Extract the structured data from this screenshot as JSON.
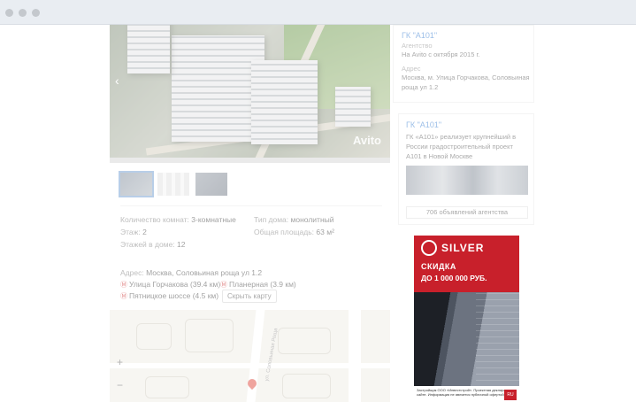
{
  "window": {
    "controls": [
      "close",
      "minimize",
      "maximize"
    ]
  },
  "listing": {
    "photo_watermark": "Avito",
    "params": [
      {
        "label": "Количество комнат:",
        "value": "3-комнатные"
      },
      {
        "label": "Этаж:",
        "value": "2"
      },
      {
        "label": "Этажей в доме:",
        "value": "12"
      },
      {
        "label": "Тип дома:",
        "value": "монолитный"
      },
      {
        "label": "Общая площадь:",
        "value": "63 м²"
      }
    ],
    "address_label": "Адрес:",
    "address_value": "Москва, Соловьиная роща ул 1.2",
    "metro": [
      {
        "name": "Улица Горчакова",
        "distance": "(39.4 км)"
      },
      {
        "name": "Планерная",
        "distance": "(3.9 км)"
      },
      {
        "name": "Пятницкое шоссе",
        "distance": "(4.5 км)"
      }
    ],
    "hide_map_label": "Скрыть карту",
    "map": {
      "street_label": "ул. Соловьиная Роща",
      "zoom_in": "+",
      "zoom_out": "−"
    }
  },
  "seller": {
    "name": "ГК \"А101\"",
    "type": "Агентство",
    "since": "На Avito с октября 2015 г.",
    "address_label": "Адрес",
    "address": "Москва, м. Улица Горчакова, Соловьиная роща ул 1.2"
  },
  "promo": {
    "name": "ГК \"А101\"",
    "description": "ГК «А101» реализует крупнейший в России градостроительный проект А101 в Новой Москве",
    "listings_link": "706 объявлений агентства"
  },
  "banner": {
    "brand": "SILVER",
    "line1": "СКИДКА",
    "line2": "ДО 1 000 000 РУБ.",
    "footer": "Застройщик ООО «Инвестстрой». Проектная декларация на сайте. Информация не является публичной офертой.",
    "badge": "RU"
  }
}
